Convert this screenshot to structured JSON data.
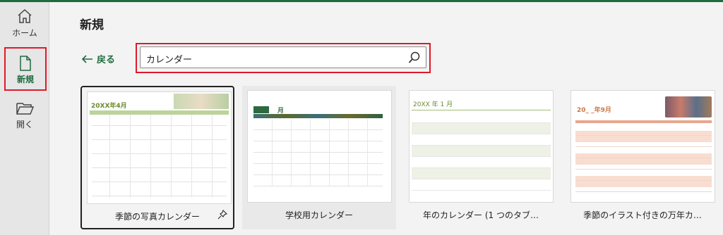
{
  "sidebar": {
    "home_label": "ホーム",
    "new_label": "新規",
    "open_label": "開く"
  },
  "main": {
    "title": "新規",
    "back_label": "戻る",
    "search": {
      "value": "カレンダー"
    }
  },
  "templates": [
    {
      "title": "季節の写真カレンダー",
      "preview_heading": "20XX年4月"
    },
    {
      "title": "学校用カレンダー",
      "preview_heading": "月"
    },
    {
      "title": "年のカレンダー (1 つのタブ…",
      "preview_heading": "20XX 年 1 月"
    },
    {
      "title": "季節のイラスト付きの万年カ…",
      "preview_heading": "20_ _年9月"
    }
  ],
  "colors": {
    "accent": "#1e6b3f",
    "highlight_outline": "#e0192a"
  }
}
